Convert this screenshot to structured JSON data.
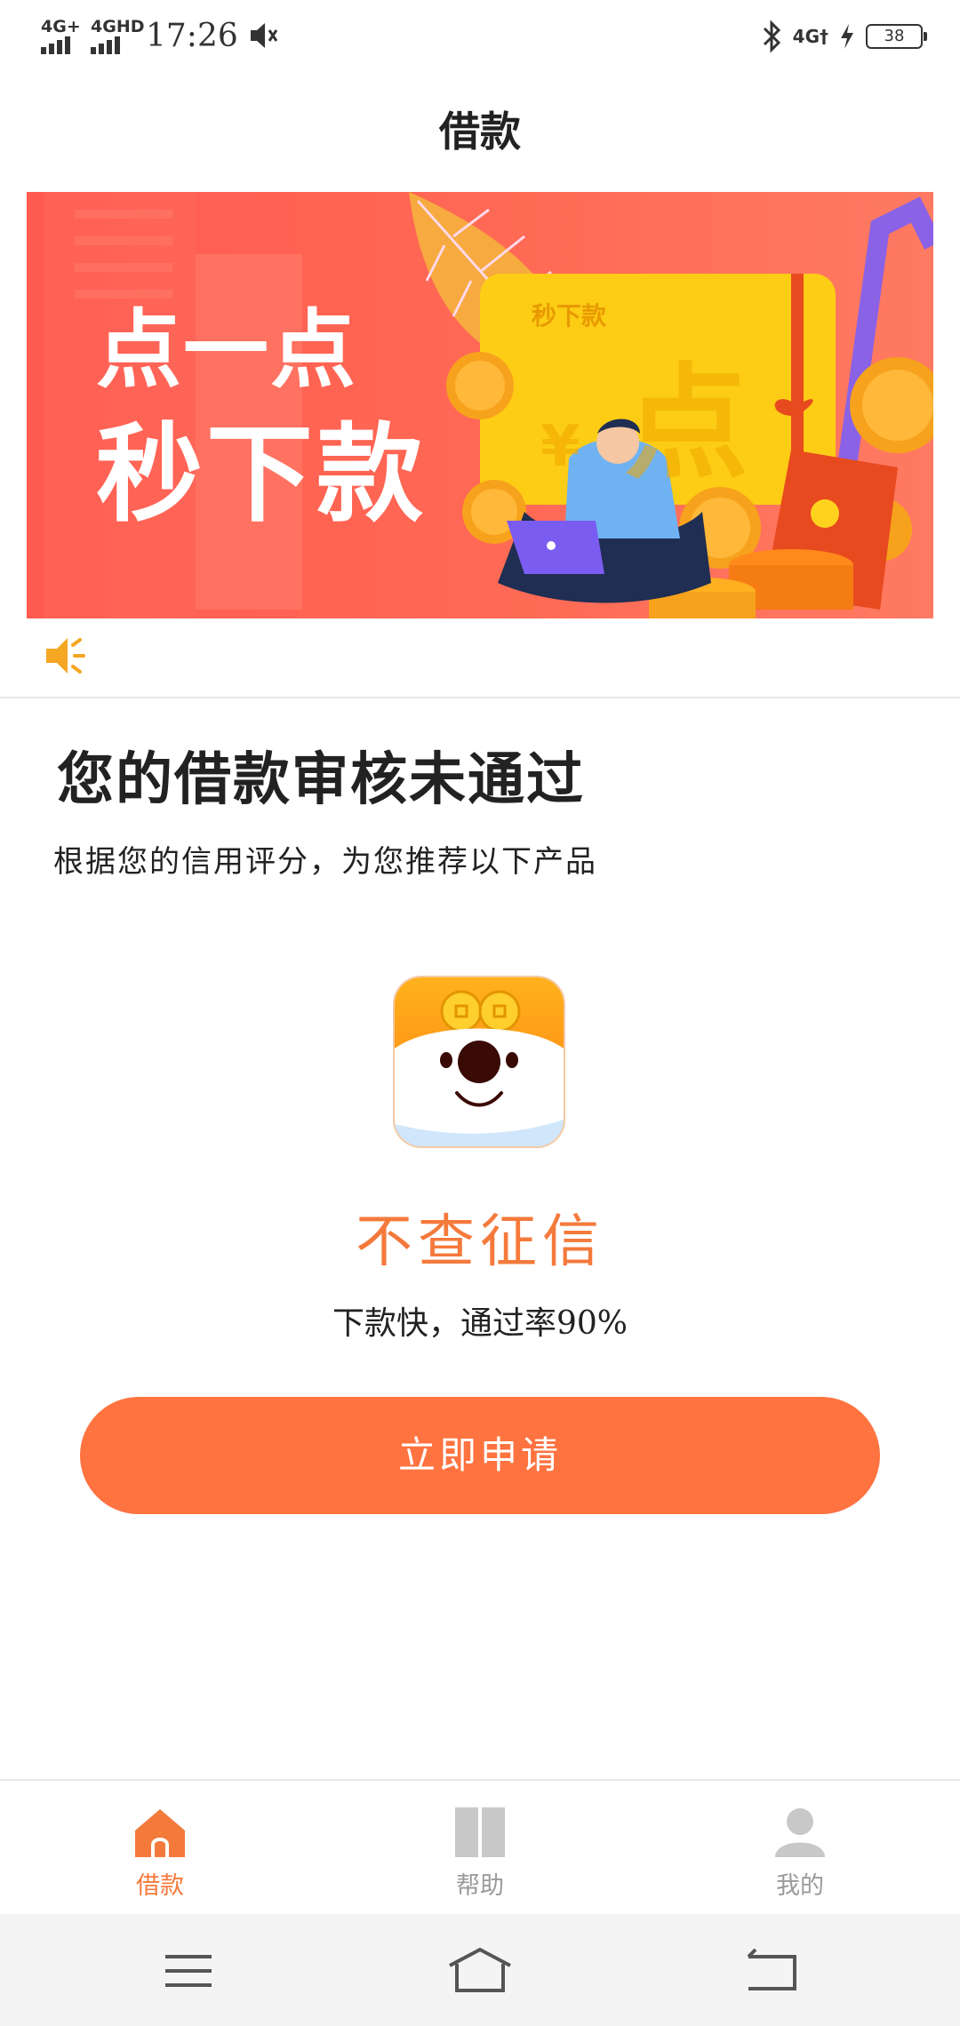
{
  "status_bar": {
    "signal1_label": "4G+",
    "signal2_label": "4GHD",
    "time": "17:26",
    "network_label": "4G†",
    "battery_level": "38"
  },
  "header": {
    "title": "借款"
  },
  "banner": {
    "line1": "点一点",
    "line2": "秒下款",
    "card_brand": "秒下款",
    "card_char": "点",
    "card_symbol": "¥"
  },
  "notice": {
    "icon": "speaker-icon"
  },
  "result": {
    "headline": "您的借款审核未通过",
    "subline": "根据您的信用评分，为您推荐以下产品"
  },
  "product": {
    "name": "不查征信",
    "description": "下款快，通过率90%",
    "button_label": "立即申请"
  },
  "bottom_nav": {
    "items": [
      {
        "label": "借款",
        "icon": "home-icon",
        "active": true
      },
      {
        "label": "帮助",
        "icon": "book-icon",
        "active": false
      },
      {
        "label": "我的",
        "icon": "user-icon",
        "active": false
      }
    ]
  },
  "system_nav": {
    "icons": [
      "menu-icon",
      "home-outline-icon",
      "back-icon"
    ]
  },
  "colors": {
    "accent": "#ff7340",
    "product_name": "#f47a3c",
    "banner": "#ff5a4f",
    "inactive": "#bdbdbd"
  }
}
